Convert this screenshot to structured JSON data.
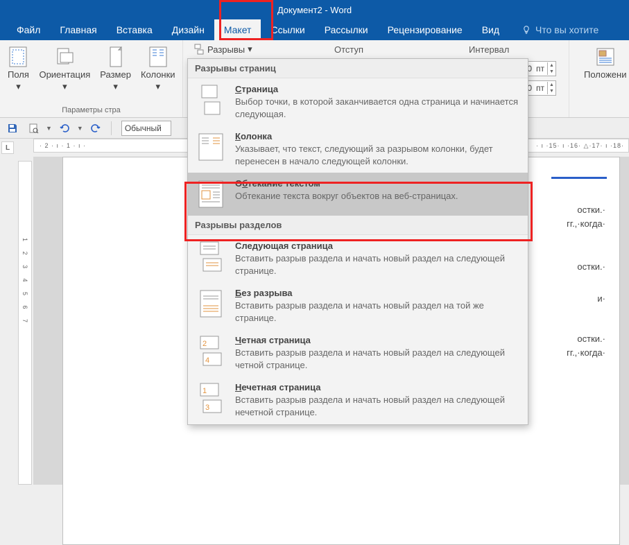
{
  "title": "Документ2 - Word",
  "tabs": {
    "file": "Файл",
    "home": "Главная",
    "insert": "Вставка",
    "design": "Дизайн",
    "layout": "Макет",
    "references": "Ссылки",
    "mailings": "Рассылки",
    "review": "Рецензирование",
    "view": "Вид",
    "tellme": "Что вы хотите"
  },
  "ribbon": {
    "margins": "Поля",
    "orientation": "Ориентация",
    "size": "Размер",
    "columns": "Колонки",
    "page_setup_label": "Параметры стра",
    "breaks": "Разрывы",
    "indent_label": "Отступ",
    "spacing_label": "Интервал",
    "position": "Положени",
    "spin_value": "0",
    "spin_unit": "пт"
  },
  "breaks_menu": {
    "page_header": "Разрывы страниц",
    "section_header": "Разрывы разделов",
    "items": [
      {
        "title": "Страница",
        "desc": "Выбор точки, в которой заканчивается одна страница и начинается следующая."
      },
      {
        "title": "Колонка",
        "desc": "Указывает, что текст, следующий за разрывом колонки, будет перенесен в начало следующей колонки."
      },
      {
        "title": "Обтекание текстом",
        "desc": "Обтекание текста вокруг объектов на веб-страницах."
      },
      {
        "title": "Следующая страница",
        "desc": "Вставить разрыв раздела и начать новый раздел на следующей странице."
      },
      {
        "title": "Без разрыва",
        "desc": "Вставить разрыв раздела и начать новый раздел на той же странице."
      },
      {
        "title": "Четная страница",
        "desc": "Вставить разрыв раздела и начать новый раздел на следующей четной странице."
      },
      {
        "title": "Нечетная страница",
        "desc": "Вставить разрыв раздела и начать новый раздел на следующей нечетной странице."
      }
    ]
  },
  "qat": {
    "style": "Обычный"
  },
  "ruler_text": "· 2 · ı · 1 · ı ·",
  "ruler_tail": "· ı ·15· ı ·16· △·17· ı ·18·",
  "doc_fragments": {
    "f1": "остки.·",
    "f2": "гг.,·когда·",
    "f3": "остки.·",
    "f4": "и·",
    "f5": "остки.·",
    "f6": "гг.,·когда·"
  }
}
